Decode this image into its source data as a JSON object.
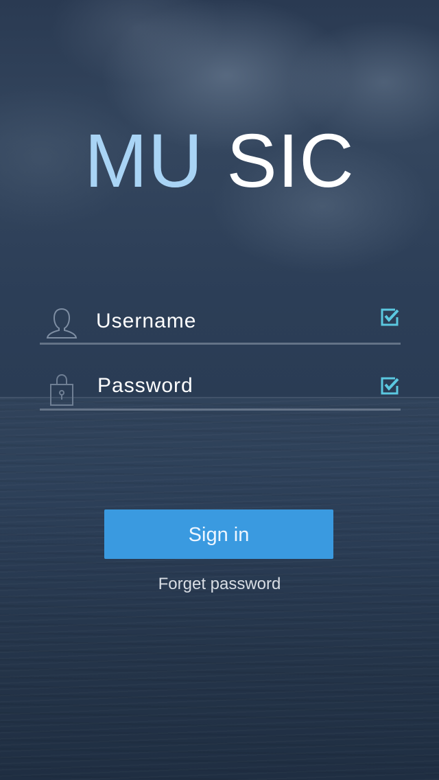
{
  "app": {
    "logo_part1": "MU",
    "logo_part2": "SIC"
  },
  "form": {
    "username": {
      "value": "Username",
      "icon": "user-icon",
      "status_icon": "checkbox-checked-icon"
    },
    "password": {
      "value": "Password",
      "icon": "lock-icon",
      "status_icon": "checkbox-checked-icon"
    }
  },
  "actions": {
    "signin_label": "Sign in",
    "forgot_label": "Forget password"
  },
  "colors": {
    "accent": "#3a9ae0",
    "logo_light": "#a9d4f5",
    "check": "#5bc8e0"
  }
}
